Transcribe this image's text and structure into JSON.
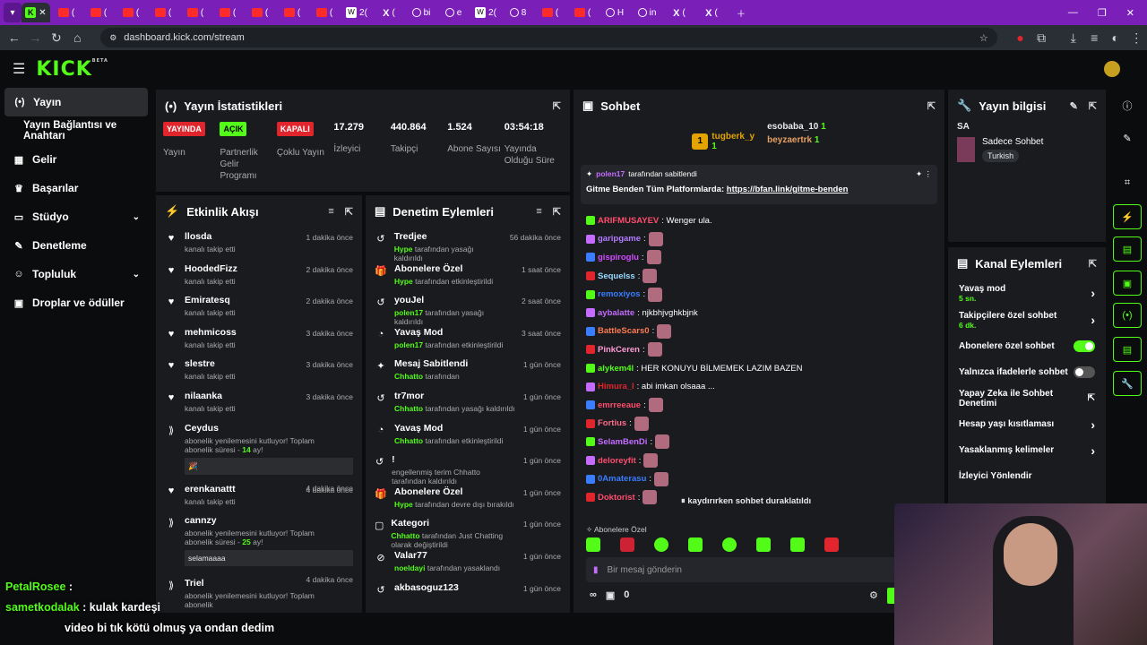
{
  "browser": {
    "tabs": [
      {
        "type": "k",
        "label": ""
      },
      {
        "type": "yt",
        "label": "("
      },
      {
        "type": "yt",
        "label": "("
      },
      {
        "type": "yt",
        "label": "("
      },
      {
        "type": "yt",
        "label": "("
      },
      {
        "type": "yt",
        "label": "("
      },
      {
        "type": "yt",
        "label": "("
      },
      {
        "type": "yt",
        "label": "("
      },
      {
        "type": "yt",
        "label": "("
      },
      {
        "type": "yt",
        "label": "("
      },
      {
        "type": "w",
        "label": "2("
      },
      {
        "type": "x",
        "label": "("
      },
      {
        "type": "g",
        "label": "bi"
      },
      {
        "type": "g",
        "label": "e"
      },
      {
        "type": "w",
        "label": "2("
      },
      {
        "type": "g",
        "label": "8"
      },
      {
        "type": "yt",
        "label": "("
      },
      {
        "type": "yt",
        "label": "("
      },
      {
        "type": "g",
        "label": "H"
      },
      {
        "type": "g",
        "label": "in"
      },
      {
        "type": "x",
        "label": "("
      },
      {
        "type": "x",
        "label": "("
      }
    ],
    "url": "dashboard.kick.com/stream"
  },
  "header": {
    "logo": "KICK",
    "logo_sup": "BETA"
  },
  "sidebar": {
    "items": [
      {
        "icon": "(•)",
        "label": "Yayın"
      },
      {
        "icon": "",
        "label": "Yayın Bağlantısı ve Anahtarı"
      },
      {
        "icon": "▦",
        "label": "Gelir"
      },
      {
        "icon": "♛",
        "label": "Başarılar"
      },
      {
        "icon": "▭",
        "label": "Stüdyo"
      },
      {
        "icon": "✎",
        "label": "Denetleme"
      },
      {
        "icon": "☺",
        "label": "Topluluk"
      },
      {
        "icon": "▣",
        "label": "Droplar ve ödüller"
      }
    ]
  },
  "stats": {
    "title": "Yayın İstatistikleri",
    "items": [
      {
        "badge": "YAYINDA",
        "badge_color": "#e0252d",
        "badge_text": "#fff",
        "label": "Yayın"
      },
      {
        "badge": "AÇIK",
        "badge_color": "#53fc18",
        "badge_text": "#000",
        "label": "Partnerlik Gelir Programı"
      },
      {
        "badge": "KAPALI",
        "badge_color": "#e0252d",
        "badge_text": "#fff",
        "label": "Çoklu Yayın"
      },
      {
        "value": "17.279",
        "label": "İzleyici"
      },
      {
        "value": "440.864",
        "label": "Takipçi"
      },
      {
        "value": "1.524",
        "label": "Abone Sayısı"
      },
      {
        "value": "03:54:18",
        "label": "Yayında Olduğu Süre"
      }
    ]
  },
  "activity": {
    "title": "Etkinlik Akışı",
    "events": [
      {
        "name": "llosda",
        "sub": "kanalı takip etti",
        "time": "1 dakika önce"
      },
      {
        "name": "HoodedFizz",
        "sub": "kanalı takip etti",
        "time": "2 dakika önce"
      },
      {
        "name": "Emiratesq",
        "sub": "kanalı takip etti",
        "time": "2 dakika önce"
      },
      {
        "name": "mehmicoss",
        "sub": "kanalı takip etti",
        "time": "3 dakika önce"
      },
      {
        "name": "slestre",
        "sub": "kanalı takip etti",
        "time": "3 dakika önce"
      },
      {
        "name": "nilaanka",
        "sub": "kanalı takip etti",
        "time": "3 dakika önce"
      }
    ],
    "sub1": {
      "name": "Ceydus",
      "time": "4 dakika önce",
      "text": "abonelik yenilemesini kutluyor! Toplam abonelik süresi - ",
      "months": "14",
      "suffix": " ay!",
      "msg": "🎉"
    },
    "event7": {
      "name": "erenkanattt",
      "sub": "kanalı takip etti",
      "time": "4 dakika önce"
    },
    "sub2": {
      "name": "cannzy",
      "time": "4 dakika önce",
      "text": "abonelik yenilemesini kutluyor! Toplam abonelik süresi - ",
      "months": "25",
      "suffix": " ay!",
      "msg": "selamaaaa"
    },
    "sub3": {
      "name": "Triel",
      "time": "4 dakika önce",
      "text": "abonelik yenilemesini kutluyor! Toplam abonelik"
    }
  },
  "moderation": {
    "title": "Denetim Eylemleri",
    "events": [
      {
        "icon": "↺",
        "name": "Tredjee",
        "who": "Hype",
        "sub": " tarafından yasağı kaldırıldı",
        "time": "56 dakika önce"
      },
      {
        "icon": "🎁",
        "name": "Abonelere Özel",
        "who": "Hype",
        "sub": " tarafından etkinleştirildi",
        "time": "1 saat önce"
      },
      {
        "icon": "↺",
        "name": "youJel",
        "who": "polen17",
        "sub": " tarafından yasağı kaldırıldı",
        "time": "2 saat önce"
      },
      {
        "icon": "◔",
        "name": "Yavaş Mod",
        "who": "polen17",
        "sub": " tarafından etkinleştirildi",
        "time": "3 saat önce"
      },
      {
        "icon": "✦",
        "name": "Mesaj Sabitlendi",
        "who": "Chhatto",
        "sub": " tarafından",
        "time": "1 gün önce"
      },
      {
        "icon": "↺",
        "name": "tr7mor",
        "who": "Chhatto",
        "sub": " tarafından yasağı kaldırıldı",
        "time": "1 gün önce"
      },
      {
        "icon": "◔",
        "name": "Yavaş Mod",
        "who": "Chhatto",
        "sub": " tarafından etkinleştirildi",
        "time": "1 gün önce"
      },
      {
        "icon": "↺",
        "name": "!",
        "who": "",
        "sub": "engellenmiş terim Chhatto tarafından kaldırıldı",
        "time": "1 gün önce"
      },
      {
        "icon": "🎁",
        "name": "Abonelere Özel",
        "who": "Hype",
        "sub": " tarafından devre dışı bırakıldı",
        "time": "1 gün önce"
      },
      {
        "icon": "▢",
        "name": "Kategori",
        "who": "Chhatto",
        "sub": " tarafından Just Chatting olarak değiştirildi",
        "time": "1 gün önce"
      },
      {
        "icon": "⊘",
        "name": "Valar77",
        "who": "noeldayi",
        "sub": " tarafından yasaklandı",
        "time": "1 gün önce"
      },
      {
        "icon": "↺",
        "name": "akbasoguz123",
        "who": "",
        "sub": "",
        "time": "1 gün önce"
      }
    ]
  },
  "chat": {
    "title": "Sohbet",
    "top": {
      "u1": "tugberk_y",
      "c1": "1",
      "u2": "esobaba_10",
      "c2": "1",
      "u3": "beyzaertrk",
      "c3": "1"
    },
    "pinned": {
      "by": "polen17",
      "label": " tarafından sabitlendi",
      "text": "Gitme Benden Tüm Platformlarda: ",
      "link": "https://bfan.link/gitme-benden"
    },
    "messages": [
      {
        "u": "ARIFMUSAYEV",
        "c": "#ff4d6d",
        "t": ": Wenger ula."
      },
      {
        "u": "garipgame",
        "c": "#b47cff",
        "t": ":"
      },
      {
        "u": "gispiroglu",
        "c": "#d04bff",
        "t": ":"
      },
      {
        "u": "Sequelss",
        "c": "#9ad8ff",
        "t": ":"
      },
      {
        "u": "remoxiyos",
        "c": "#3a7dff",
        "t": ":"
      },
      {
        "u": "aybalatte",
        "c": "#c56cff",
        "t": ": njkbhjvghkbjnk"
      },
      {
        "u": "BattleScars0",
        "c": "#ff7b52",
        "t": ":"
      },
      {
        "u": "PinkCeren",
        "c": "#ff9ad6",
        "t": ":"
      },
      {
        "u": "alykem4l",
        "c": "#53fc18",
        "t": ": HER KONUYU BİLMEMEK LAZIM BAZEN"
      },
      {
        "u": "Himura_l",
        "c": "#e0252d",
        "t": ": abi imkan olsaaa ..."
      },
      {
        "u": "emrreeaue",
        "c": "#ff4d6d",
        "t": ":"
      },
      {
        "u": "Fortius",
        "c": "#ff6b8b",
        "t": ":"
      },
      {
        "u": "SelamBenDi",
        "c": "#c56cff",
        "t": ":"
      },
      {
        "u": "deloreyfit",
        "c": "#ff4d6d",
        "t": ":"
      },
      {
        "u": "0Amaterasu",
        "c": "#3a7dff",
        "t": ":"
      },
      {
        "u": "Doktorist",
        "c": "#ff4d6d",
        "t": ":"
      }
    ],
    "paused": "kaydırırken sohbet duraklatıldı",
    "mode": "Abonelere Özel",
    "placeholder": "Bir mesaj gönderin",
    "count": "0"
  },
  "info": {
    "title": "Yayın bilgisi",
    "label": "SA",
    "category": "Sadece Sohbet",
    "tag": "Turkish"
  },
  "channel": {
    "title": "Kanal Eylemleri",
    "actions": [
      {
        "label": "Yavaş mod",
        "sub": "5 sn.",
        "ctrl": "arrow"
      },
      {
        "label": "Takipçilere özel sohbet",
        "sub": "6 dk.",
        "ctrl": "arrow"
      },
      {
        "label": "Abonelere özel sohbet",
        "sub": "",
        "ctrl": "on"
      },
      {
        "label": "Yalnızca ifadelerle sohbet",
        "sub": "",
        "ctrl": "off"
      },
      {
        "label": "Yapay Zeka ile Sohbet Denetimi",
        "sub": "",
        "ctrl": "ext"
      },
      {
        "label": "Hesap yaşı kısıtlaması",
        "sub": "",
        "ctrl": "arrow"
      },
      {
        "label": "Yasaklanmış kelimeler",
        "sub": "",
        "ctrl": "arrow"
      },
      {
        "label": "İzleyici Yönlendir",
        "sub": "",
        "ctrl": ""
      }
    ]
  },
  "overlay": {
    "lines": [
      {
        "u": "PetalRosee",
        "t": " :"
      },
      {
        "u": "sametkodalak",
        "t": " : kulak kardeşi"
      },
      {
        "u": "",
        "t": "video bi tık kötü olmuş ya ondan dedim"
      }
    ]
  },
  "colors": {
    "accent": "#53fc18",
    "panel": "#191b1f",
    "bg": "#0b0c0e"
  }
}
